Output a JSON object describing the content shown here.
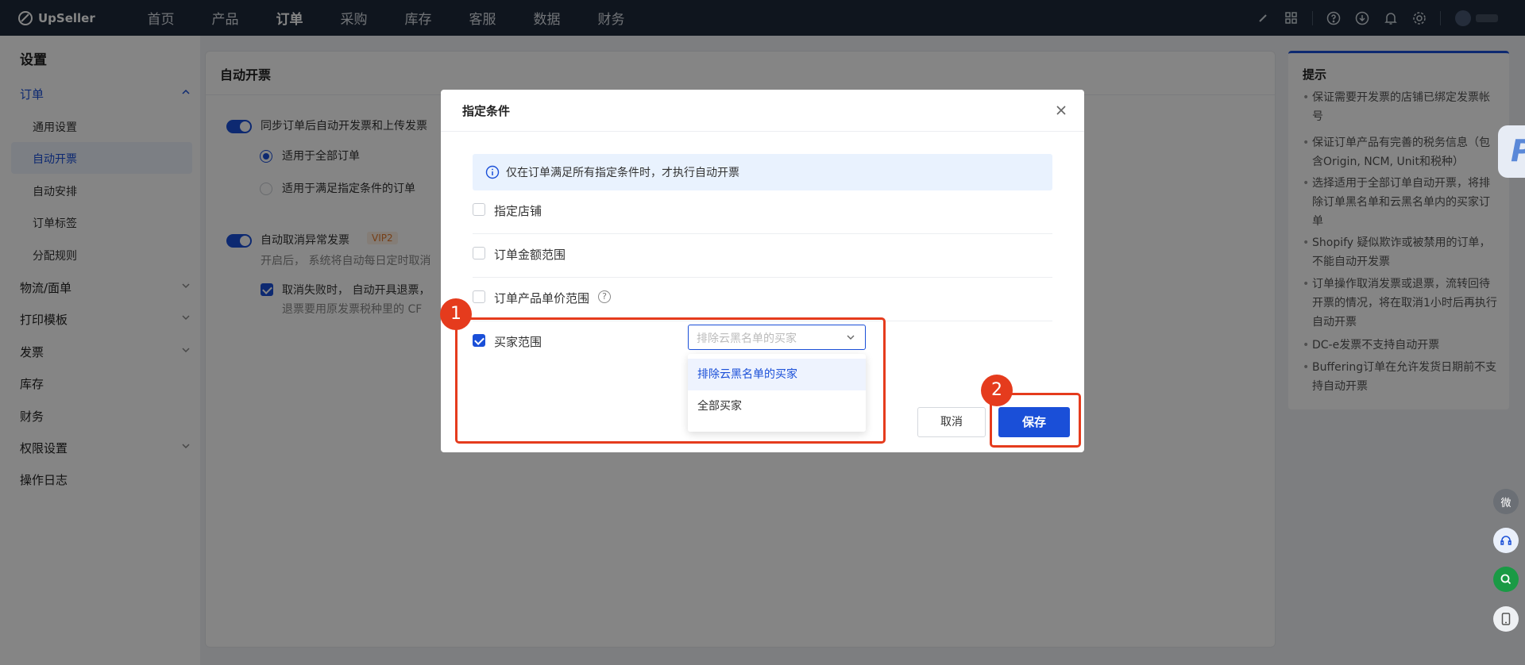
{
  "app": {
    "brand": "UpSeller"
  },
  "topnav": {
    "items": [
      "首页",
      "产品",
      "订单",
      "采购",
      "库存",
      "客服",
      "数据",
      "财务"
    ],
    "active": "订单"
  },
  "sidebar": {
    "title": "设置",
    "order": "订单",
    "sub": [
      "通用设置",
      "自动开票",
      "自动安排",
      "订单标签",
      "分配规则"
    ],
    "items": [
      "物流/面单",
      "打印模板",
      "发票",
      "库存",
      "财务",
      "权限设置",
      "操作日志"
    ]
  },
  "main": {
    "title": "自动开票",
    "sync_label": "同步订单后自动开发票和上传发票",
    "radio_all": "适用于全部订单",
    "radio_cond": "适用于满足指定条件的订单",
    "cancel_label": "自动取消异常发票",
    "vip": "VIP2",
    "cancel_desc": "开启后， 系统将自动每日定时取消",
    "fail_label": "取消失败时， 自动开具退票，",
    "fail_desc": "退票要用原发票税种里的 CF"
  },
  "tips": {
    "title": "提示",
    "items": [
      "保证需要开发票的店铺已绑定发票帐号",
      "保证订单产品有完善的税务信息（包含Origin, NCM, Unit和税种）",
      "选择适用于全部订单自动开票，将排除订单黑名单和云黑名单内的买家订单",
      "Shopify 疑似欺诈或被禁用的订单，不能自动开发票",
      "订单操作取消发票或退票，流转回待开票的情况，将在取消1小时后再执行自动开票",
      "DC-e发票不支持自动开票",
      "Buffering订单在允许发货日期前不支持自动开票"
    ]
  },
  "fab": {
    "wechat": "微"
  },
  "dialog": {
    "title": "指定条件",
    "info": "仅在订单满足所有指定条件时，才执行自动开票",
    "conditions": [
      {
        "label": "指定店铺",
        "checked": false
      },
      {
        "label": "订单金额范围",
        "checked": false
      },
      {
        "label": "订单产品单价范围",
        "checked": false
      },
      {
        "label": "买家范围",
        "checked": true
      }
    ],
    "select_placeholder": "排除云黑名单的买家",
    "options": [
      "排除云黑名单的买家",
      "全部买家"
    ],
    "cancel": "取消",
    "save": "保存"
  },
  "annotations": {
    "m1": "1",
    "m2": "2"
  },
  "colors": {
    "primary": "#1a4fd8",
    "highlight": "#e53b1d",
    "topbar": "#1d2a3a"
  }
}
